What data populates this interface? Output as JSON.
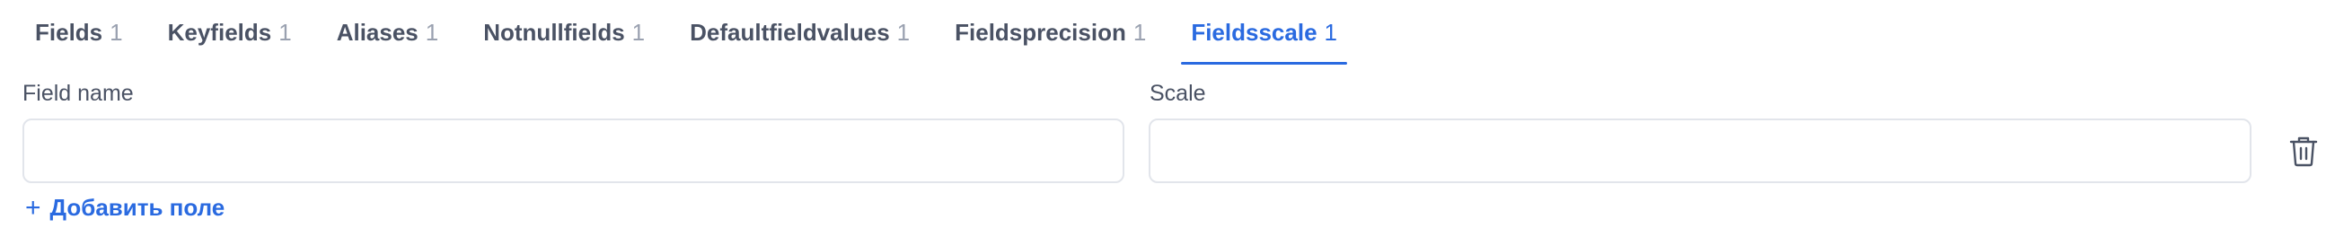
{
  "tabs": [
    {
      "label": "Fields",
      "count": "1"
    },
    {
      "label": "Keyfields",
      "count": "1"
    },
    {
      "label": "Aliases",
      "count": "1"
    },
    {
      "label": "Notnullfields",
      "count": "1"
    },
    {
      "label": "Defaultfieldvalues",
      "count": "1"
    },
    {
      "label": "Fieldsprecision",
      "count": "1"
    },
    {
      "label": "Fieldsscale",
      "count": "1"
    }
  ],
  "active_tab": "Fieldsscale",
  "form": {
    "field_name_label": "Field name",
    "field_name_value": "",
    "scale_label": "Scale",
    "scale_value": "",
    "delete_icon": "trash-icon"
  },
  "add_field": {
    "plus_icon": "+",
    "label": "Добавить поле"
  },
  "colors": {
    "accent": "#2a6ae0",
    "text": "#4a5264",
    "muted": "#9aa1b0",
    "border": "#e2e5eb"
  }
}
